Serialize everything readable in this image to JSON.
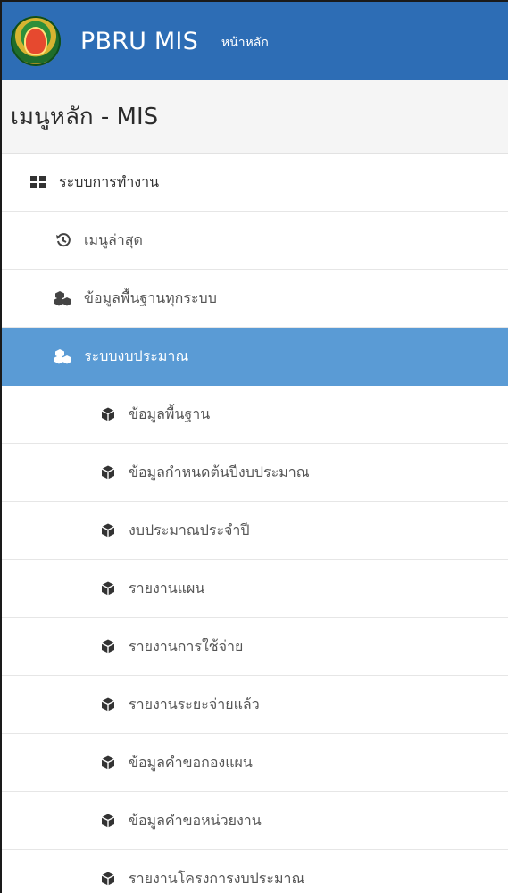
{
  "topbar": {
    "brand": "PBRU MIS",
    "home_link": "หน้าหลัก"
  },
  "menu": {
    "header": "เมนูหลัก - MIS",
    "section": {
      "label": "ระบบการทำงาน",
      "icon": "grid-icon"
    },
    "items": [
      {
        "label": "เมนูล่าสุด",
        "icon": "history-icon"
      },
      {
        "label": "ข้อมูลพื้นฐานทุกระบบ",
        "icon": "cubes-icon"
      },
      {
        "label": "ระบบงบประมาณ",
        "icon": "cubes-icon",
        "active": true
      }
    ],
    "subitems": [
      {
        "label": "ข้อมูลพื้นฐาน",
        "icon": "cube-icon"
      },
      {
        "label": "ข้อมูลกำหนดต้นปีงบประมาณ",
        "icon": "cube-icon"
      },
      {
        "label": "งบประมาณประจำปี",
        "icon": "cube-icon"
      },
      {
        "label": "รายงานแผน",
        "icon": "cube-icon"
      },
      {
        "label": "รายงานการใช้จ่าย",
        "icon": "cube-icon"
      },
      {
        "label": "รายงานระยะจ่ายแล้ว",
        "icon": "cube-icon"
      },
      {
        "label": "ข้อมูลคำขอกองแผน",
        "icon": "cube-icon"
      },
      {
        "label": "ข้อมูลคำขอหน่วยงาน",
        "icon": "cube-icon"
      },
      {
        "label": "รายงานโครงการงบประมาณ",
        "icon": "cube-icon"
      }
    ]
  },
  "colors": {
    "topbar": "#2d6db5",
    "active": "#5a9bd5"
  }
}
